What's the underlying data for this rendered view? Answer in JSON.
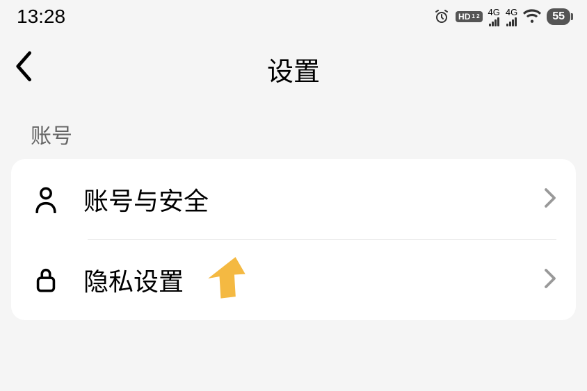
{
  "status_bar": {
    "time": "13:28",
    "hd_label": "HD",
    "sim_indicator": "1 2",
    "network_label": "4G",
    "battery_level": "55"
  },
  "header": {
    "title": "设置"
  },
  "section": {
    "label": "账号",
    "items": [
      {
        "label": "账号与安全",
        "icon": "user-icon"
      },
      {
        "label": "隐私设置",
        "icon": "lock-icon"
      }
    ]
  }
}
